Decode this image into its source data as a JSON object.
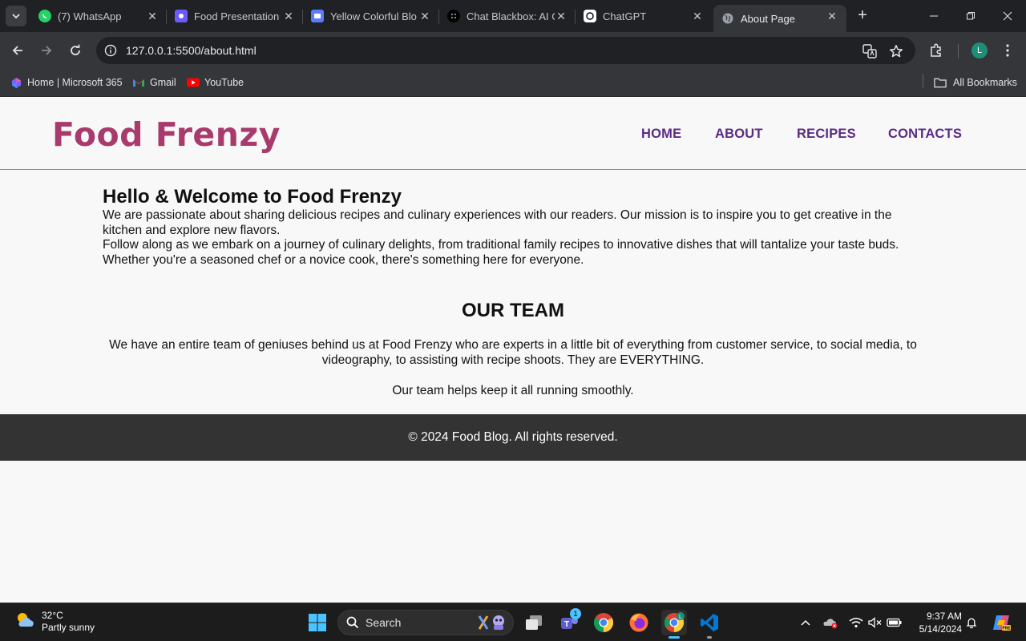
{
  "browser": {
    "tabs": [
      {
        "title": "(7) WhatsApp"
      },
      {
        "title": "Food Presentation"
      },
      {
        "title": "Yellow Colorful Blo"
      },
      {
        "title": "Chat Blackbox: AI C"
      },
      {
        "title": "ChatGPT"
      },
      {
        "title": "About Page"
      }
    ],
    "url": "127.0.0.1:5500/about.html",
    "profile_initial": "L",
    "bookmarks": [
      {
        "label": "Home | Microsoft 365"
      },
      {
        "label": "Gmail"
      },
      {
        "label": "YouTube"
      }
    ],
    "all_bookmarks": "All Bookmarks"
  },
  "site": {
    "logo": "Food Frenzy",
    "nav": [
      "HOME",
      "ABOUT",
      "RECIPES",
      "CONTACTS"
    ],
    "welcome_title": "Hello & Welcome to Food Frenzy",
    "welcome_p1": "We are passionate about sharing delicious recipes and culinary experiences with our readers. Our mission is to inspire you to get creative in the kitchen and explore new flavors.",
    "welcome_p2": "Follow along as we embark on a journey of culinary delights, from traditional family recipes to innovative dishes that will tantalize your taste buds. Whether you're a seasoned chef or a novice cook, there's something here for everyone.",
    "team_title": "OUR TEAM",
    "team_p1": "We have an entire team of geniuses behind us at Food Frenzy who are experts in a little bit of everything from customer service, to social media, to videography, to assisting with recipe shoots. They are EVERYTHING.",
    "team_p2": "Our team helps keep it all running smoothly.",
    "footer": "© 2024 Food Blog. All rights reserved."
  },
  "taskbar": {
    "weather_temp": "32°C",
    "weather_desc": "Partly sunny",
    "search_label": "Search",
    "teams_badge": "1",
    "time": "9:37 AM",
    "date": "5/14/2024"
  },
  "colors": {
    "logo": "#a83b6c",
    "nav": "#5b2a86",
    "footer_bg": "#333333"
  }
}
